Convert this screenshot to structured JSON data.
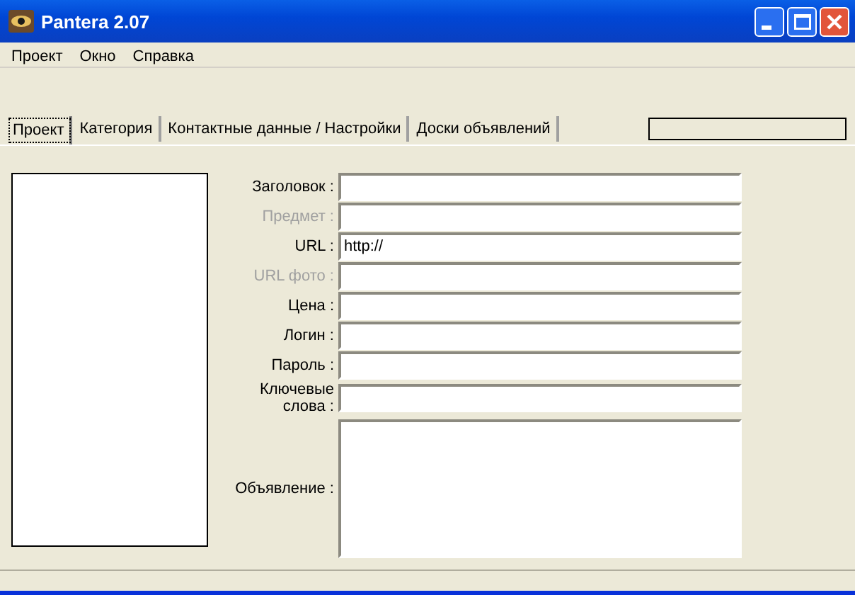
{
  "window": {
    "title": "Pantera 2.07"
  },
  "menu": [
    "Проект",
    "Окно",
    "Справка"
  ],
  "tabs": [
    {
      "label": "Проект",
      "selected": true
    },
    {
      "label": "Категория",
      "selected": false
    },
    {
      "label": "Контактные данные / Настройки",
      "selected": false
    },
    {
      "label": "Доски объявлений",
      "selected": false
    }
  ],
  "fields": [
    {
      "kind": "line",
      "label": "Заголовок :",
      "disabled": false
    },
    {
      "kind": "line",
      "label": "Предмет :",
      "disabled": true
    },
    {
      "kind": "line",
      "label": "URL :",
      "disabled": false,
      "value": "http://"
    },
    {
      "kind": "line",
      "label": "URL фото :",
      "disabled": true
    },
    {
      "kind": "line",
      "label": "Цена :",
      "disabled": false
    },
    {
      "kind": "line",
      "label": "Логин :",
      "disabled": false
    },
    {
      "kind": "line",
      "label": "Пароль :",
      "disabled": false
    },
    {
      "kind": "line",
      "label": "Ключевые слова :",
      "disabled": false
    },
    {
      "kind": "area",
      "label": "Объявление :",
      "disabled": false
    }
  ]
}
